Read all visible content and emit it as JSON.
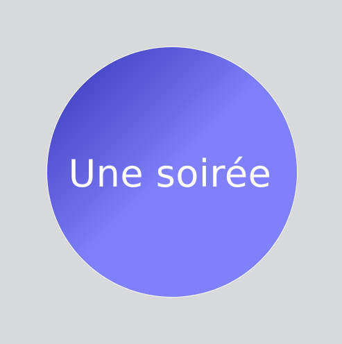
{
  "badge": {
    "text": "Une soirée"
  },
  "colors": {
    "background": "#d8d9da",
    "circle_dark": "#3535b6",
    "circle_light": "#8080fa",
    "text": "#ffffff"
  }
}
